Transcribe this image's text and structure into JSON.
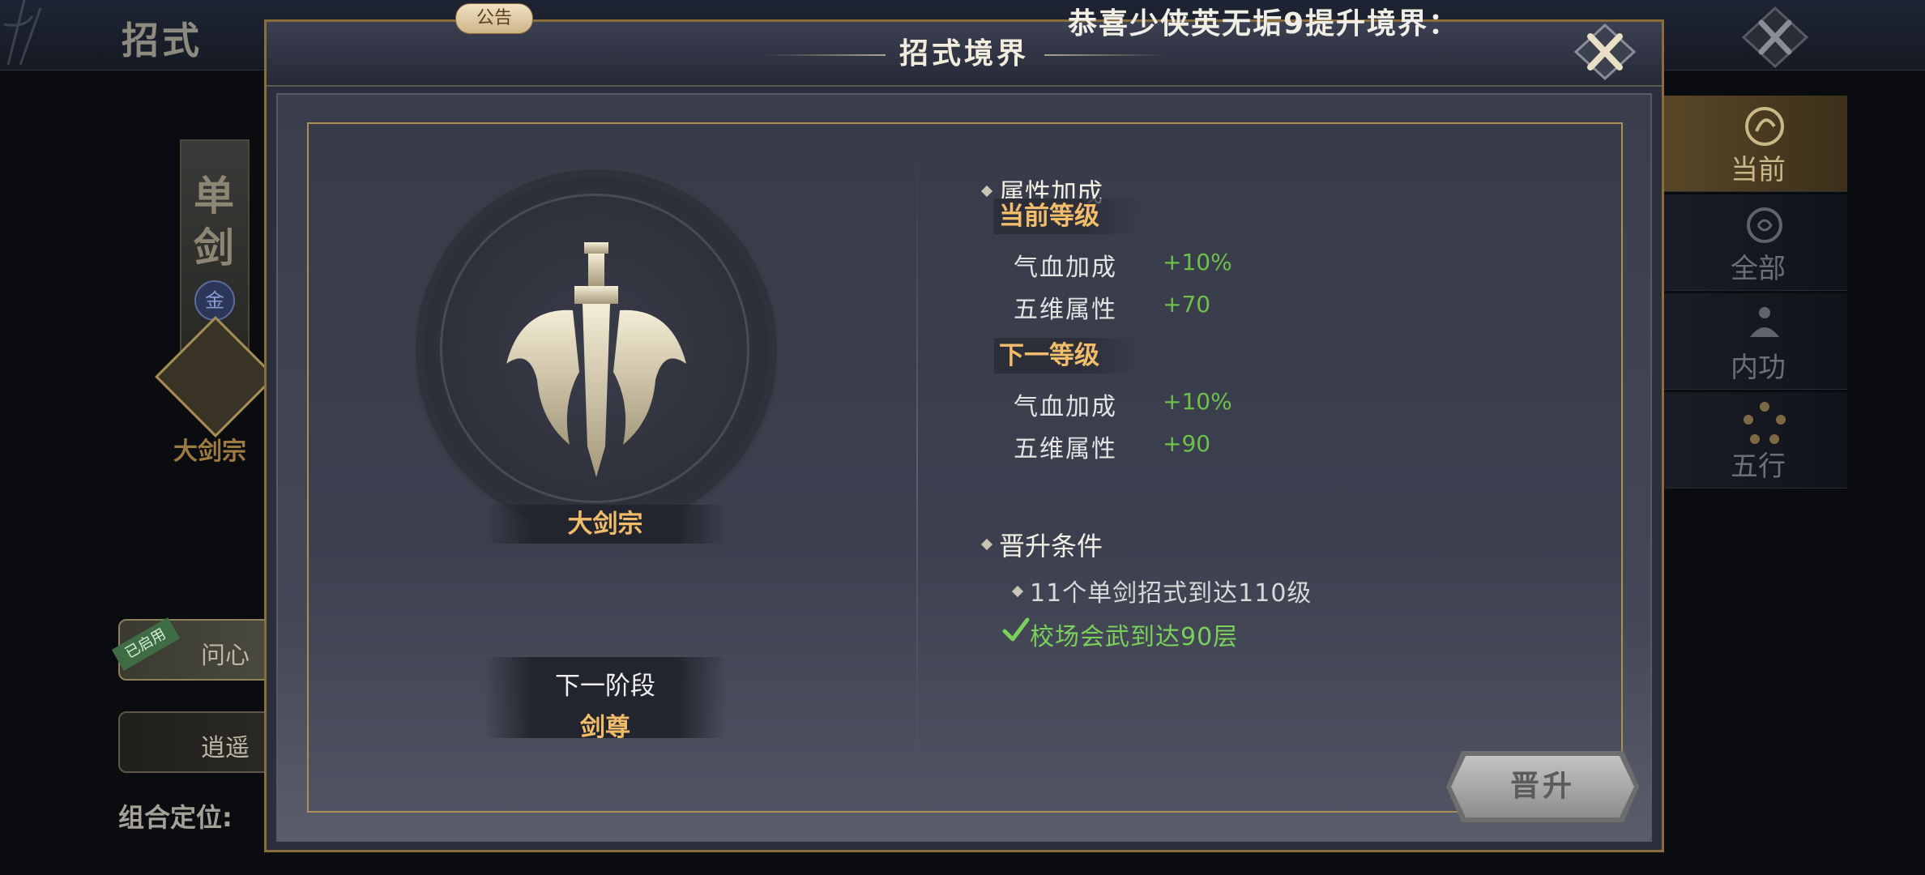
{
  "background": {
    "screen_title": "招式",
    "announcement_badge": "公告",
    "marquee": "恭喜少侠英无垢9提升境界：",
    "left_card_text": "单剑",
    "left_card_badge": "金",
    "left_school_label": "大剑宗",
    "left_buttons": [
      {
        "label": "问心",
        "tag": "已启用"
      },
      {
        "label": "逍遥"
      }
    ],
    "combo_label": "组合定位:",
    "right_tabs": [
      {
        "label": "当前",
        "icon": "swirl-icon",
        "active": true
      },
      {
        "label": "全部",
        "icon": "spiral-icon",
        "active": false
      },
      {
        "label": "内功",
        "icon": "meditation-icon",
        "active": false
      },
      {
        "label": "五行",
        "icon": "five-elements-icon",
        "active": false
      }
    ]
  },
  "dialog": {
    "title": "招式境界",
    "emblem_name": "大剑宗",
    "next_stage_label": "下一阶段",
    "next_stage_value": "剑尊",
    "attributes_heading": "属性加成",
    "current_level_heading": "当前等级",
    "current_level": [
      {
        "name": "气血加成",
        "value": "+10%"
      },
      {
        "name": "五维属性",
        "value": "+70"
      }
    ],
    "next_level_heading": "下一等级",
    "next_level": [
      {
        "name": "气血加成",
        "value": "+10%"
      },
      {
        "name": "五维属性",
        "value": "+90"
      }
    ],
    "conditions_heading": "晋升条件",
    "conditions": [
      {
        "text": "11个单剑招式到达110级",
        "met": false
      },
      {
        "text": "校场会武到达90层",
        "met": true
      }
    ],
    "upgrade_button": "晋升"
  },
  "colors": {
    "gold_text": "#f2bd6a",
    "green_value": "#6ec04a",
    "frame_gold": "#b08d55"
  }
}
